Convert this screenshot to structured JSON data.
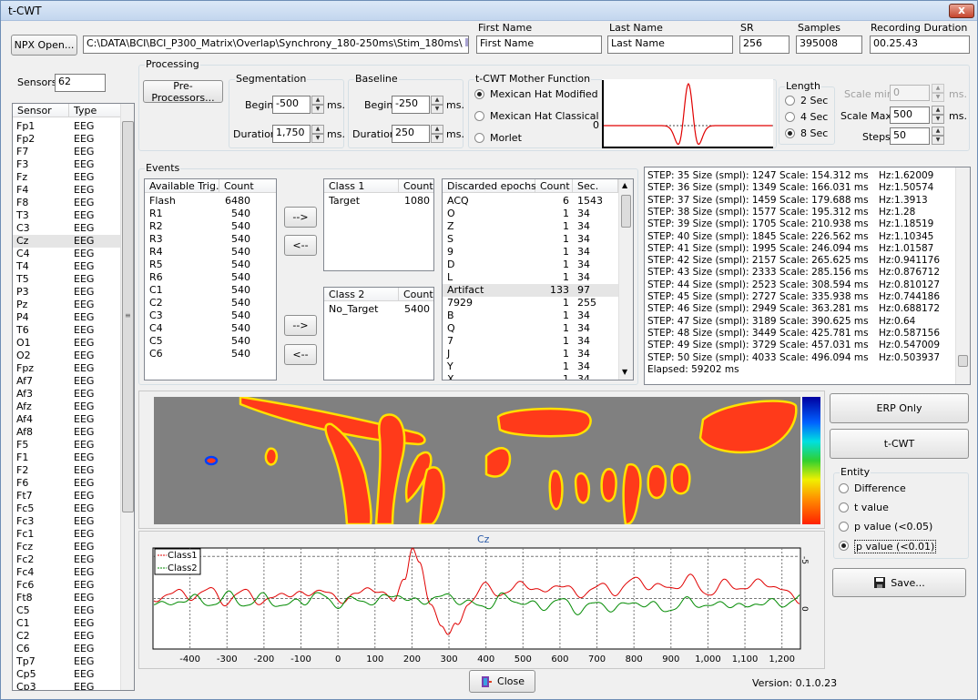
{
  "window": {
    "title": "t-CWT",
    "close_glyph": "x"
  },
  "top": {
    "npx_button": "NPX Open...",
    "path": "C:\\DATA\\BCI\\BCI_P300_Matrix\\Overlap\\Synchrony_180-250ms\\Stim_180ms\\",
    "first_name_label": "First Name",
    "first_name": "First Name",
    "last_name_label": "Last Name",
    "last_name": "Last Name",
    "sr_label": "SR",
    "sr": "256",
    "samples_label": "Samples",
    "samples": "395008",
    "duration_label": "Recording Duration",
    "duration": "00.25.43"
  },
  "sensors": {
    "label": "Sensors",
    "count": "62",
    "col_sensor": "Sensor",
    "col_type": "Type",
    "rows": [
      [
        "Fp1",
        "EEG"
      ],
      [
        "Fp2",
        "EEG"
      ],
      [
        "F7",
        "EEG"
      ],
      [
        "F3",
        "EEG"
      ],
      [
        "Fz",
        "EEG"
      ],
      [
        "F4",
        "EEG"
      ],
      [
        "F8",
        "EEG"
      ],
      [
        "T3",
        "EEG"
      ],
      [
        "C3",
        "EEG"
      ],
      [
        "Cz",
        "EEG"
      ],
      [
        "C4",
        "EEG"
      ],
      [
        "T4",
        "EEG"
      ],
      [
        "T5",
        "EEG"
      ],
      [
        "P3",
        "EEG"
      ],
      [
        "Pz",
        "EEG"
      ],
      [
        "P4",
        "EEG"
      ],
      [
        "T6",
        "EEG"
      ],
      [
        "O1",
        "EEG"
      ],
      [
        "O2",
        "EEG"
      ],
      [
        "Fpz",
        "EEG"
      ],
      [
        "Af7",
        "EEG"
      ],
      [
        "Af3",
        "EEG"
      ],
      [
        "Afz",
        "EEG"
      ],
      [
        "Af4",
        "EEG"
      ],
      [
        "Af8",
        "EEG"
      ],
      [
        "F5",
        "EEG"
      ],
      [
        "F1",
        "EEG"
      ],
      [
        "F2",
        "EEG"
      ],
      [
        "F6",
        "EEG"
      ],
      [
        "Ft7",
        "EEG"
      ],
      [
        "Fc5",
        "EEG"
      ],
      [
        "Fc3",
        "EEG"
      ],
      [
        "Fc1",
        "EEG"
      ],
      [
        "Fcz",
        "EEG"
      ],
      [
        "Fc2",
        "EEG"
      ],
      [
        "Fc4",
        "EEG"
      ],
      [
        "Fc6",
        "EEG"
      ],
      [
        "Ft8",
        "EEG"
      ],
      [
        "C5",
        "EEG"
      ],
      [
        "C1",
        "EEG"
      ],
      [
        "C2",
        "EEG"
      ],
      [
        "C6",
        "EEG"
      ],
      [
        "Tp7",
        "EEG"
      ],
      [
        "Cp5",
        "EEG"
      ],
      [
        "Cp3",
        "EEG"
      ]
    ],
    "selected": "Cz"
  },
  "processing": {
    "title": "Processing",
    "preproc_button": "Pre-Processors...",
    "seg_title": "Segmentation",
    "begin_label": "Begin",
    "begin": "-500",
    "duration_label": "Duration",
    "duration": "1,750",
    "ms": "ms.",
    "base_title": "Baseline",
    "base_begin": "-250",
    "base_duration": "250",
    "mother_title": "t-CWT Mother Function",
    "mothers": [
      "Mexican Hat Modified",
      "Mexican Hat Classical",
      "Morlet"
    ],
    "mother_selected": 0,
    "length_title": "Length",
    "lengths": [
      "2 Sec",
      "4 Sec",
      "8 Sec"
    ],
    "length_selected": 2,
    "scale_min_label": "Scale min",
    "scale_min": "0",
    "scale_max_label": "Scale Max",
    "scale_max": "500",
    "steps_label": "Steps",
    "steps": "50",
    "zero_label": "0"
  },
  "events": {
    "title": "Events",
    "avail_col": "Available Trig.",
    "count_col": "Count",
    "avail": [
      [
        "Flash",
        "6480"
      ],
      [
        "R1",
        "540"
      ],
      [
        "R2",
        "540"
      ],
      [
        "R3",
        "540"
      ],
      [
        "R4",
        "540"
      ],
      [
        "R5",
        "540"
      ],
      [
        "R6",
        "540"
      ],
      [
        "C1",
        "540"
      ],
      [
        "C2",
        "540"
      ],
      [
        "C3",
        "540"
      ],
      [
        "C4",
        "540"
      ],
      [
        "C5",
        "540"
      ],
      [
        "C6",
        "540"
      ]
    ],
    "class1_col": "Class 1",
    "class1": [
      [
        "Target",
        "1080"
      ]
    ],
    "class2_col": "Class 2",
    "class2": [
      [
        "No_Target",
        "5400"
      ]
    ],
    "right_arrow": "-->",
    "left_arrow": "<--",
    "disc_col": "Discarded epochs",
    "disc_count_col": "Count",
    "disc_sec_col": "Sec.",
    "discarded": [
      [
        "ACQ",
        "6",
        "1543"
      ],
      [
        "O",
        "1",
        "34"
      ],
      [
        "Z",
        "1",
        "34"
      ],
      [
        "S",
        "1",
        "34"
      ],
      [
        "9",
        "1",
        "34"
      ],
      [
        "D",
        "1",
        "34"
      ],
      [
        "L",
        "1",
        "34"
      ],
      [
        "Artifact",
        "133",
        "97"
      ],
      [
        "7929",
        "1",
        "255"
      ],
      [
        "B",
        "1",
        "34"
      ],
      [
        "Q",
        "1",
        "34"
      ],
      [
        "7",
        "1",
        "34"
      ],
      [
        "J",
        "1",
        "34"
      ],
      [
        "Y",
        "1",
        "34"
      ],
      [
        "X",
        "1",
        "34"
      ]
    ]
  },
  "log": {
    "lines": [
      "STEP: 35 Size (smpl): 1247   Scale: 154.312 ms  Hz:1.62009",
      "STEP: 36 Size (smpl): 1349   Scale: 166.031 ms  Hz:1.50574",
      "STEP: 37 Size (smpl): 1459   Scale: 179.688 ms  Hz:1.3913",
      "STEP: 38 Size (smpl): 1577   Scale: 195.312 ms  Hz:1.28",
      "STEP: 39 Size (smpl): 1705   Scale: 210.938 ms  Hz:1.18519",
      "STEP: 40 Size (smpl): 1845   Scale: 226.562 ms  Hz:1.10345",
      "STEP: 41 Size (smpl): 1995   Scale: 246.094 ms  Hz:1.01587",
      "STEP: 42 Size (smpl): 2157   Scale: 265.625 ms  Hz:0.941176",
      "STEP: 43 Size (smpl): 2333   Scale: 285.156 ms  Hz:0.876712",
      "STEP: 44 Size (smpl): 2523   Scale: 308.594 ms  Hz:0.810127",
      "STEP: 45 Size (smpl): 2727   Scale: 335.938 ms  Hz:0.744186",
      "STEP: 46 Size (smpl): 2949   Scale: 363.281 ms  Hz:0.688172",
      "STEP: 47 Size (smpl): 3189   Scale: 390.625 ms  Hz:0.64",
      "STEP: 48 Size (smpl): 3449   Scale: 425.781 ms  Hz:0.587156",
      "STEP: 49 Size (smpl): 3729   Scale: 457.031 ms  Hz:0.547009",
      "STEP: 50 Size (smpl): 4033   Scale: 496.094 ms  Hz:0.503937",
      "Elapsed: 59202 ms"
    ]
  },
  "right": {
    "erp_button": "ERP Only",
    "tcwt_button": "t-CWT",
    "entity_title": "Entity",
    "entities": [
      "Difference",
      "t value",
      "p value (<0.05)",
      "p value (<0.01)"
    ],
    "entity_selected": 3,
    "save_button": "Save..."
  },
  "plot": {
    "channel": "Cz",
    "legend": [
      "Class1",
      "Class2"
    ],
    "colors": {
      "class1": "#e00000",
      "class2": "#008a00"
    },
    "ytick_top": "-5",
    "ytick_zero": "0"
  },
  "bottom": {
    "close_button": "Close",
    "version": "Version: 0.1.0.23"
  },
  "chart_data": {
    "type": "line",
    "title": "Cz",
    "xlabel": "",
    "ylabel": "",
    "xlim": [
      -500,
      1250
    ],
    "ylim": [
      6,
      -6
    ],
    "xticks": [
      "-400",
      "-300",
      "-200",
      "-100",
      "0",
      "100",
      "200",
      "300",
      "400",
      "500",
      "600",
      "700",
      "800",
      "900",
      "1,000",
      "1,100",
      "1,200"
    ],
    "series": [
      {
        "name": "Class1",
        "x": [
          -500,
          -450,
          -400,
          -350,
          -300,
          -250,
          -200,
          -150,
          -100,
          -50,
          0,
          50,
          100,
          150,
          180,
          200,
          220,
          250,
          280,
          300,
          320,
          350,
          400,
          450,
          500,
          550,
          600,
          650,
          700,
          750,
          800,
          850,
          900,
          950,
          1000,
          1050,
          1100,
          1150,
          1200,
          1250
        ],
        "values": [
          0.3,
          -0.8,
          -0.2,
          -1.0,
          0.4,
          -0.9,
          0.6,
          -0.7,
          -0.3,
          -1.1,
          0.2,
          -0.5,
          -1.3,
          0.4,
          -2.5,
          -6.2,
          -3.8,
          0.5,
          3.0,
          4.6,
          3.2,
          0.6,
          -1.5,
          -0.4,
          -2.0,
          -0.6,
          -1.8,
          -0.3,
          -1.5,
          -0.8,
          -2.2,
          -1.5,
          -1.2,
          -2.4,
          -0.6,
          -1.8,
          -1.2,
          -2.1,
          -0.9,
          0.1
        ]
      },
      {
        "name": "Class2",
        "x": [
          -500,
          -450,
          -400,
          -350,
          -300,
          -250,
          -200,
          -150,
          -100,
          -50,
          0,
          50,
          100,
          150,
          200,
          250,
          300,
          350,
          400,
          450,
          500,
          550,
          600,
          650,
          700,
          750,
          800,
          850,
          900,
          950,
          1000,
          1050,
          1100,
          1150,
          1200,
          1250
        ],
        "values": [
          0.2,
          0.9,
          -0.3,
          0.8,
          -0.4,
          0.7,
          -0.2,
          0.9,
          0.3,
          -0.4,
          0.7,
          0.1,
          0.5,
          -0.6,
          0.4,
          0.1,
          -0.3,
          0.6,
          0.9,
          -0.2,
          0.5,
          1.0,
          0.2,
          1.4,
          0.6,
          1.2,
          0.4,
          0.9,
          1.3,
          0.2,
          1.0,
          0.5,
          1.1,
          0.3,
          0.8,
          -0.4
        ]
      }
    ]
  }
}
